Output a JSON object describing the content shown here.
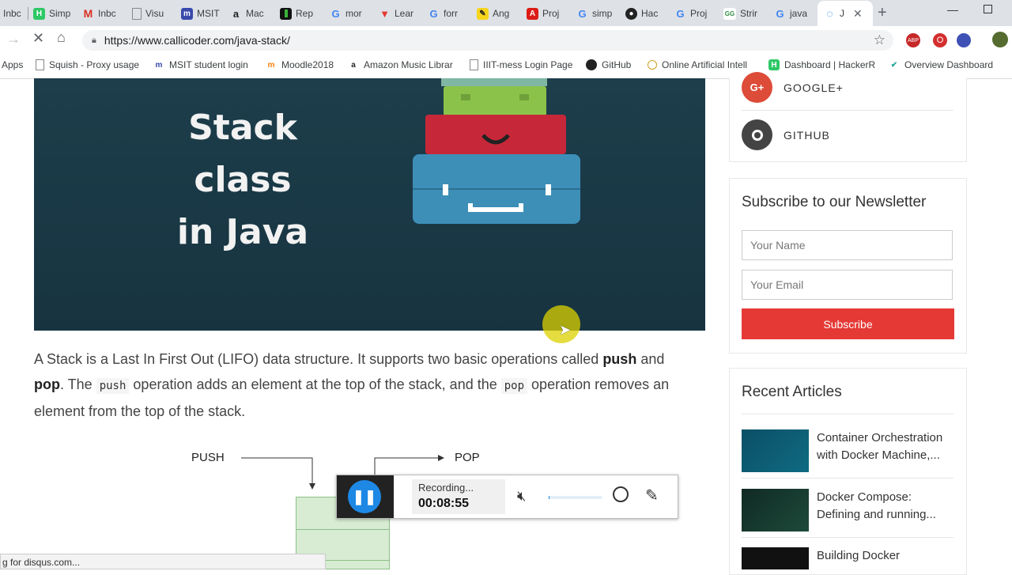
{
  "browser": {
    "tabs": [
      {
        "label": "Inbc",
        "icon": "mail-icon"
      },
      {
        "label": "Simp",
        "icon": "hackerrank-icon"
      },
      {
        "label": "Inbc",
        "icon": "gmail-icon"
      },
      {
        "label": "Visu",
        "icon": "doc-icon"
      },
      {
        "label": "MSIT",
        "icon": "msit-icon"
      },
      {
        "label": "Mac",
        "icon": "amazon-icon"
      },
      {
        "label": "Rep",
        "icon": "repl-icon"
      },
      {
        "label": "mor",
        "icon": "google-icon"
      },
      {
        "label": "Lear",
        "icon": "vue-icon"
      },
      {
        "label": "forr",
        "icon": "google-icon"
      },
      {
        "label": "Ang",
        "icon": "pencil-icon"
      },
      {
        "label": "Proj",
        "icon": "angular-icon"
      },
      {
        "label": "simp",
        "icon": "google-icon"
      },
      {
        "label": "Hac",
        "icon": "github-icon"
      },
      {
        "label": "Proj",
        "icon": "google-icon"
      },
      {
        "label": "Strir",
        "icon": "gfg-icon"
      },
      {
        "label": "java",
        "icon": "google-icon"
      },
      {
        "label": "J",
        "icon": "loading-icon"
      }
    ],
    "new_tab": "+",
    "url": "https://www.callicoder.com/java-stack/",
    "bookmarks": [
      {
        "label": "Apps"
      },
      {
        "label": "Squish - Proxy usage"
      },
      {
        "label": "MSIT student login"
      },
      {
        "label": "Moodle2018"
      },
      {
        "label": "Amazon Music Librar"
      },
      {
        "label": "IIIT-mess Login Page"
      },
      {
        "label": "GitHub"
      },
      {
        "label": "Online Artificial Intell"
      },
      {
        "label": "Dashboard | HackerR"
      },
      {
        "label": "Overview Dashboard"
      }
    ],
    "status_text": "g for disqus.com..."
  },
  "article": {
    "hero_title_line1": "Stack class",
    "hero_title_line2": "in Java",
    "intro_1": "A Stack is a Last In First Out (LIFO) data structure. It supports two basic operations called ",
    "push_bold": "push",
    "intro_2": "and ",
    "pop_bold": "pop",
    "intro_3": ". The ",
    "push_code": "push",
    "intro_4": " operation adds an element at the top of the stack, and the ",
    "pop_code": "pop",
    "intro_5": " operation removes an element from the top of the stack.",
    "diagram_push": "PUSH",
    "diagram_pop": "POP"
  },
  "sidebar": {
    "social": [
      {
        "label": "GOOGLE+",
        "icon": "google-plus-icon",
        "color": "#dd4b39"
      },
      {
        "label": "GITHUB",
        "icon": "github-icon",
        "color": "#444444"
      }
    ],
    "newsletter_title": "Subscribe to our Newsletter",
    "name_placeholder": "Your Name",
    "email_placeholder": "Your Email",
    "subscribe_label": "Subscribe",
    "recent_title": "Recent Articles",
    "articles": [
      {
        "line1": "Container Orchestration",
        "line2": "with Docker Machine,..."
      },
      {
        "line1": "Docker Compose:",
        "line2": "Defining and running..."
      },
      {
        "line1": "Building Docker",
        "line2": ""
      }
    ]
  },
  "recorder": {
    "status": "Recording...",
    "time": "00:08:55"
  },
  "colors": {
    "accent": "#e53935",
    "hero_bg": "#1b3a47"
  }
}
